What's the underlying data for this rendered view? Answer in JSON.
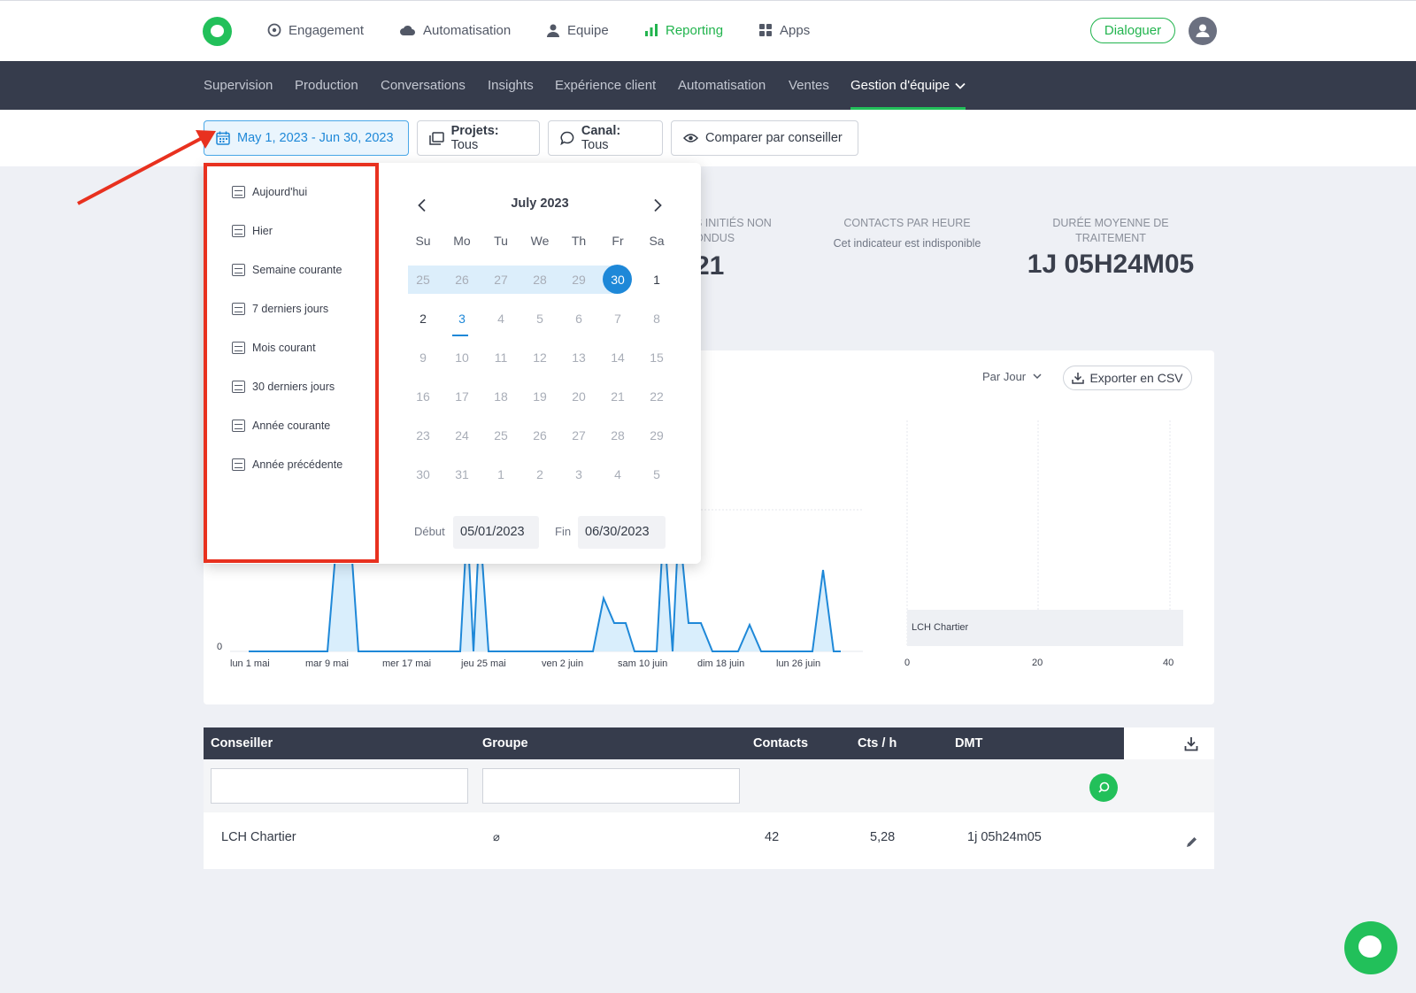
{
  "topnav": {
    "items": [
      {
        "label": "Engagement",
        "icon": "target-icon"
      },
      {
        "label": "Automatisation",
        "icon": "cloud-icon"
      },
      {
        "label": "Equipe",
        "icon": "person-icon"
      },
      {
        "label": "Reporting",
        "icon": "bar-chart-icon",
        "active": true
      },
      {
        "label": "Apps",
        "icon": "grid-icon"
      }
    ],
    "dialog_button": "Dialoguer"
  },
  "subnav": {
    "items": [
      "Supervision",
      "Production",
      "Conversations",
      "Insights",
      "Expérience client",
      "Automatisation",
      "Ventes",
      "Gestion d'équipe"
    ],
    "active": "Gestion d'équipe"
  },
  "filters": {
    "date_range": "May 1, 2023 - Jun 30, 2023",
    "projects_label": "Projets:",
    "projects_value": "Tous",
    "channel_label": "Canal:",
    "channel_value": "Tous",
    "compare": "Comparer par conseiller"
  },
  "stats": {
    "partial_title_1": "S INITIÉS NON",
    "partial_title_2": "ONDUS",
    "partial_value": "21",
    "contacts_hour_title": "CONTACTS PAR HEURE",
    "contacts_hour_note": "Cet indicateur est indisponible",
    "dmt_title_1": "DURÉE MOYENNE DE",
    "dmt_title_2": "TRAITEMENT",
    "dmt_value": "1J 05H24M05"
  },
  "chart_controls": {
    "period": "Par Jour",
    "export": "Exporter en CSV"
  },
  "chart_data": [
    {
      "type": "area",
      "x_tick_labels": [
        "lun 1 mai",
        "mar 9 mai",
        "mer 17 mai",
        "jeu 25 mai",
        "ven 2 juin",
        "sam 10 juin",
        "dim 18 juin",
        "lun 26 juin"
      ],
      "y_tick_labels": [
        "0"
      ],
      "note": "line area chart, mostly obscured by date picker overlay"
    },
    {
      "type": "bar",
      "orientation": "horizontal",
      "categories": [
        "LCH Chartier"
      ],
      "values": [
        42
      ],
      "x_tick_labels": [
        "0",
        "20",
        "40"
      ],
      "xlim": [
        0,
        42
      ]
    }
  ],
  "table": {
    "headers": [
      "Conseiller",
      "Groupe",
      "Contacts",
      "Cts / h",
      "DMT"
    ],
    "rows": [
      {
        "conseiller": "LCH Chartier",
        "groupe": "⌀",
        "contacts": "42",
        "cts_h": "5,28",
        "dmt": "1j 05h24m05"
      }
    ]
  },
  "datepicker": {
    "presets": [
      "Aujourd'hui",
      "Hier",
      "Semaine courante",
      "7 derniers jours",
      "Mois courant",
      "30 derniers jours",
      "Année courante",
      "Année précédente"
    ],
    "month_title": "July 2023",
    "weekdays": [
      "Su",
      "Mo",
      "Tu",
      "We",
      "Th",
      "Fr",
      "Sa"
    ],
    "weeks": [
      [
        "25",
        "26",
        "27",
        "28",
        "29",
        "30",
        "1"
      ],
      [
        "2",
        "3",
        "4",
        "5",
        "6",
        "7",
        "8"
      ],
      [
        "9",
        "10",
        "11",
        "12",
        "13",
        "14",
        "15"
      ],
      [
        "16",
        "17",
        "18",
        "19",
        "20",
        "21",
        "22"
      ],
      [
        "23",
        "24",
        "25",
        "26",
        "27",
        "28",
        "29"
      ],
      [
        "30",
        "31",
        "1",
        "2",
        "3",
        "4",
        "5"
      ]
    ],
    "start_label": "Début",
    "start_value": "05/01/2023",
    "end_label": "Fin",
    "end_value": "06/30/2023"
  },
  "colors": {
    "accent": "#22c05a",
    "highlight": "#e8311f",
    "selection": "#1e88d8"
  }
}
